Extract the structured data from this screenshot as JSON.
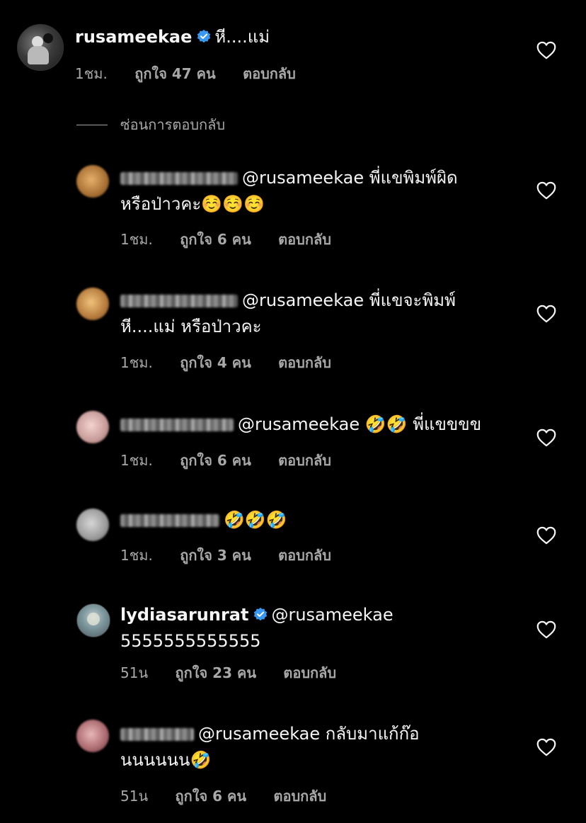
{
  "main_comment": {
    "username": "rusameekae",
    "verified": true,
    "text": "หี....แม่",
    "time": "1ชม.",
    "likes": "ถูกใจ 47 คน",
    "reply_label": "ตอบกลับ"
  },
  "hide_replies_label": "ซ่อนการตอบกลับ",
  "replies": [
    {
      "mention": "@rusameekae",
      "text_line1": "พี่แขพิมพ์ผิด",
      "text_line2": "หรือป่าวคะ",
      "emoji": "☺️☺️☺️",
      "time": "1ชม.",
      "likes": "ถูกใจ 6 คน",
      "reply_label": "ตอบกลับ"
    },
    {
      "mention": "@rusameekae",
      "text_line1": "พี่แขจะพิมพ์",
      "text_line2": "หี....แม่ หรือป่าวคะ",
      "time": "1ชม.",
      "likes": "ถูกใจ 4 คน",
      "reply_label": "ตอบกลับ"
    },
    {
      "mention": "@rusameekae",
      "emoji": "🤣🤣",
      "text_line1": "พี่แขขขข",
      "time": "1ชม.",
      "likes": "ถูกใจ 6 คน",
      "reply_label": "ตอบกลับ"
    },
    {
      "emoji": "🤣🤣🤣",
      "time": "1ชม.",
      "likes": "ถูกใจ 3 คน",
      "reply_label": "ตอบกลับ"
    },
    {
      "username": "lydiasarunrat",
      "verified": true,
      "mention": "@rusameekae",
      "text_line2": "5555555555555",
      "time": "51น",
      "likes": "ถูกใจ 23 คน",
      "reply_label": "ตอบกลับ"
    },
    {
      "mention": "@rusameekae",
      "text_line1": "กลับมาแก้ก๊อ",
      "text_line2": "นนนนนน",
      "emoji": "🤣",
      "time": "51น",
      "likes": "ถูกใจ 6 คน",
      "reply_label": "ตอบกลับ"
    }
  ],
  "icons": {
    "heart": "heart-outline-icon",
    "verified": "verified-badge-icon"
  },
  "colors": {
    "background": "#000000",
    "text_primary": "#f5f5f5",
    "text_secondary": "#a8a8a8",
    "verified_blue": "#3897f0"
  }
}
